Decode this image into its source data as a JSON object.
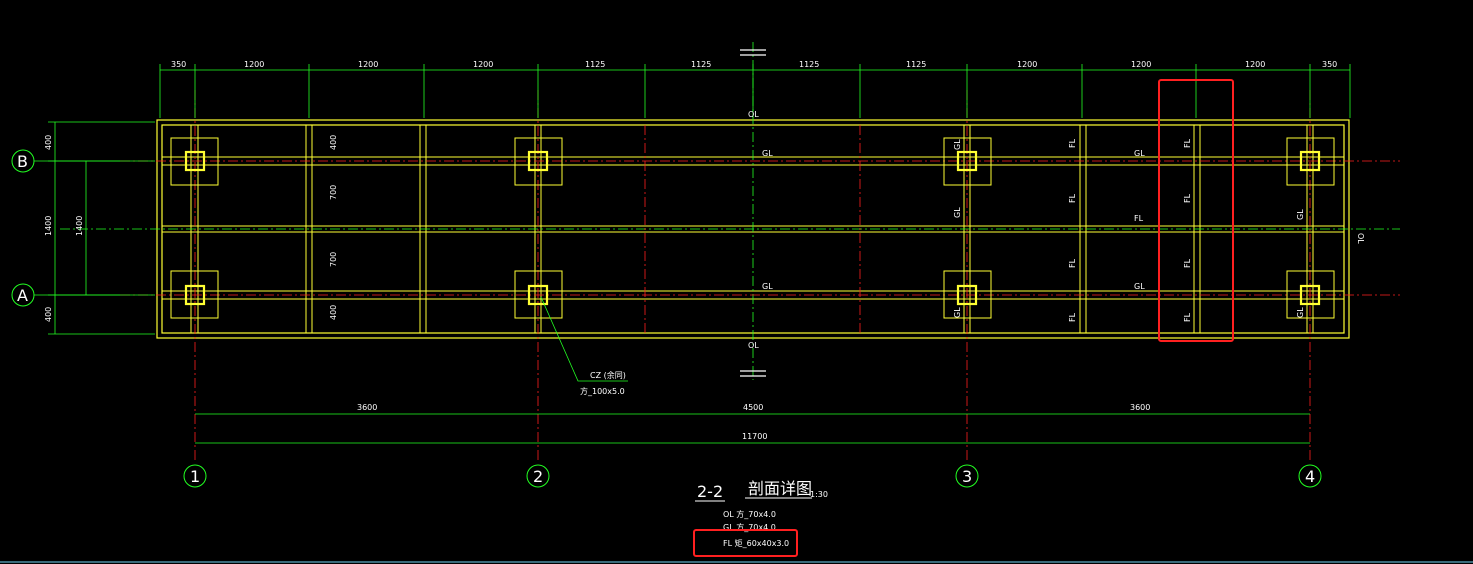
{
  "drawing": {
    "title_num": "2-2",
    "title_text": "剖面详图",
    "scale": "1:30",
    "legend": [
      "OL  方_70x4.0",
      "GL  方_70x4.0",
      "FL  矩_60x40x3.0"
    ],
    "column_note": [
      "CZ (余同)",
      "方_100x5.0"
    ],
    "top_dims": [
      "350",
      "1200",
      "1200",
      "1200",
      "1125",
      "1125",
      "1125",
      "1125",
      "1200",
      "1200",
      "1200",
      "350"
    ],
    "left_dims_outer": [
      "400",
      "1400",
      "400"
    ],
    "left_dims_inner": [
      "1400"
    ],
    "inner_dims": [
      "400",
      "700",
      "700",
      "400"
    ],
    "bottom_dims": [
      "3600",
      "4500",
      "3600"
    ],
    "total_dim": "11700",
    "grid_letters": [
      "B",
      "A"
    ],
    "grid_numbers": [
      "1",
      "2",
      "3",
      "4"
    ],
    "member_labels": {
      "ol": "OL",
      "gl": "GL",
      "fl": "FL",
      "cl": "GL",
      "right_edge": "OL"
    }
  },
  "colors": {
    "background": "#000000",
    "yellow": "#ffff33",
    "green": "#22ff22",
    "red": "#ff2020",
    "white": "#ffffff",
    "highlight": "#ff2020"
  }
}
